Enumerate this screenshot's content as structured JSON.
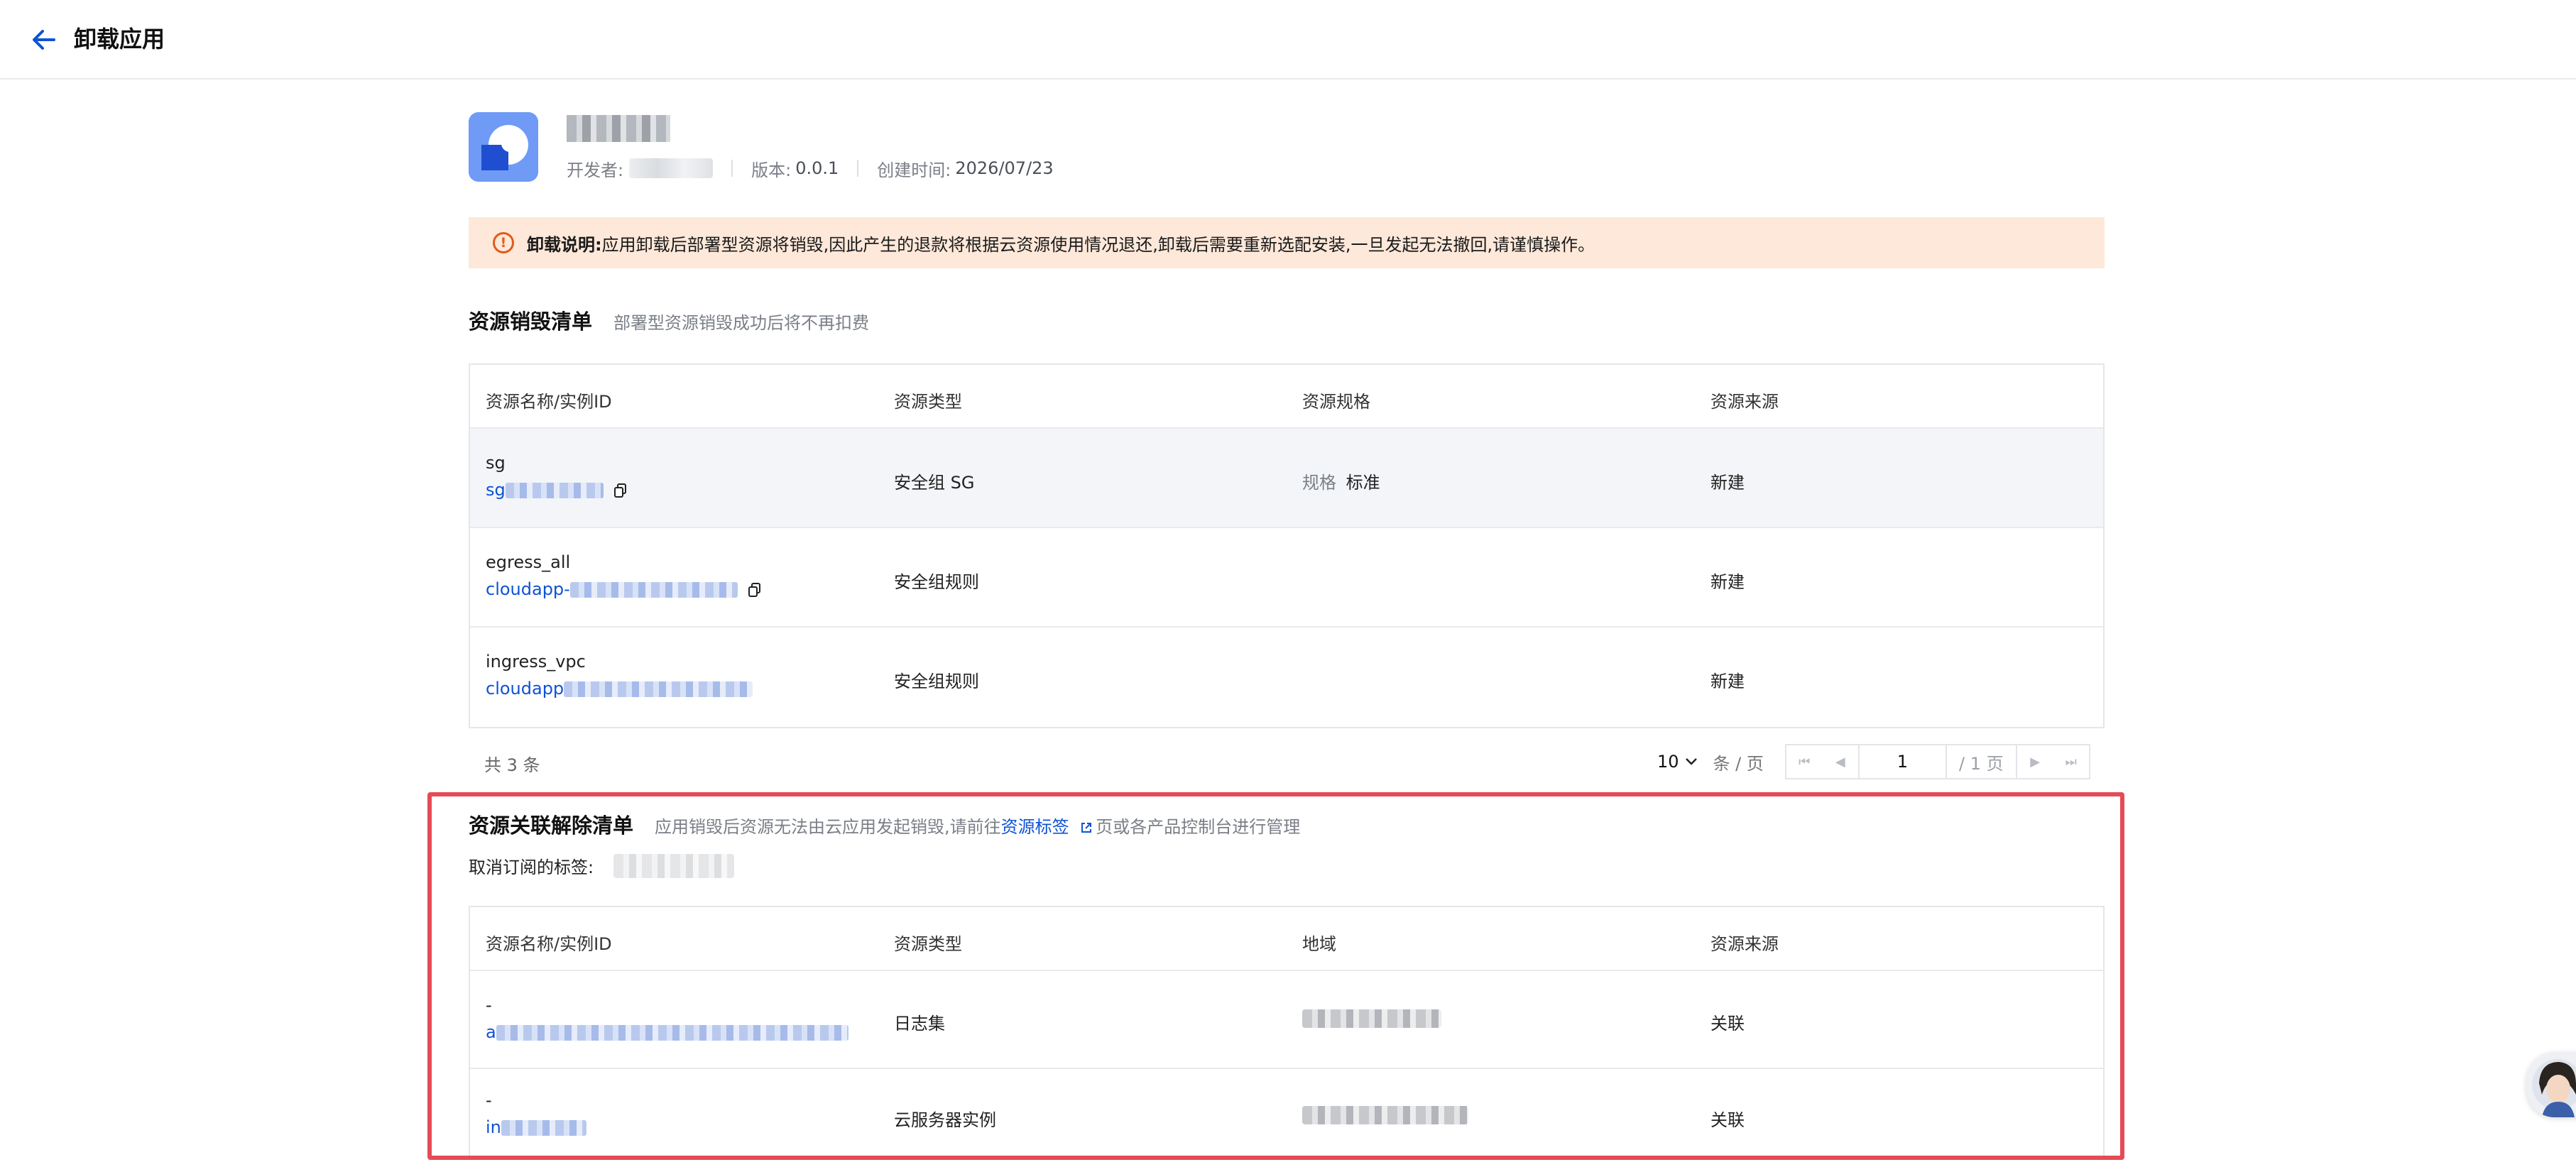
{
  "header": {
    "title": "卸载应用"
  },
  "app": {
    "developer_label": "开发者:",
    "version_label": "版本:",
    "version": "0.0.1",
    "created_label": "创建时间:",
    "created": "2026/07/23"
  },
  "notice": {
    "title": "卸载说明:",
    "text": "应用卸载后部署型资源将销毁,因此产生的退款将根据云资源使用情况退还,卸载后需要重新选配安装,一旦发起无法撤回,请谨慎操作。",
    "icon": "warning-circle-icon",
    "bg_color": "#fde8d9",
    "accent_color": "#e15b1a"
  },
  "destroy_section": {
    "title": "资源销毁清单",
    "desc": "部署型资源销毁成功后将不再扣费",
    "columns": [
      "资源名称/实例ID",
      "资源类型",
      "资源规格",
      "资源来源"
    ],
    "rows": [
      {
        "name": "sg",
        "id_prefix": "sg",
        "type": "安全组 SG",
        "spec_label": "规格",
        "spec": "标准",
        "source": "新建"
      },
      {
        "name": "egress_all",
        "id_prefix": "cloudapp-",
        "type": "安全组规则",
        "spec_label": "",
        "spec": "",
        "source": "新建"
      },
      {
        "name": "ingress_vpc",
        "id_prefix": "cloudapp",
        "type": "安全组规则",
        "spec_label": "",
        "spec": "",
        "source": "新建"
      }
    ],
    "total": "共 3 条",
    "page_size": "10",
    "page_size_unit": "条 / 页",
    "current_page": "1",
    "page_total": "/ 1 页"
  },
  "unlink_section": {
    "title": "资源关联解除清单",
    "desc_before": "应用销毁后资源无法由云应用发起销毁,请前往",
    "desc_link": "资源标签",
    "desc_after": "页或各产品控制台进行管理",
    "tag_label": "取消订阅的标签:",
    "columns": [
      "资源名称/实例ID",
      "资源类型",
      "地域",
      "资源来源"
    ],
    "rows": [
      {
        "name": "-",
        "id_prefix": "a",
        "type": "日志集",
        "source": "关联"
      },
      {
        "name": "-",
        "id_prefix": "in",
        "type": "云服务器实例",
        "source": "关联"
      }
    ]
  },
  "colors": {
    "link": "#0f52d6",
    "highlight_border": "#e44b55",
    "brand": "#5d8ef5"
  }
}
